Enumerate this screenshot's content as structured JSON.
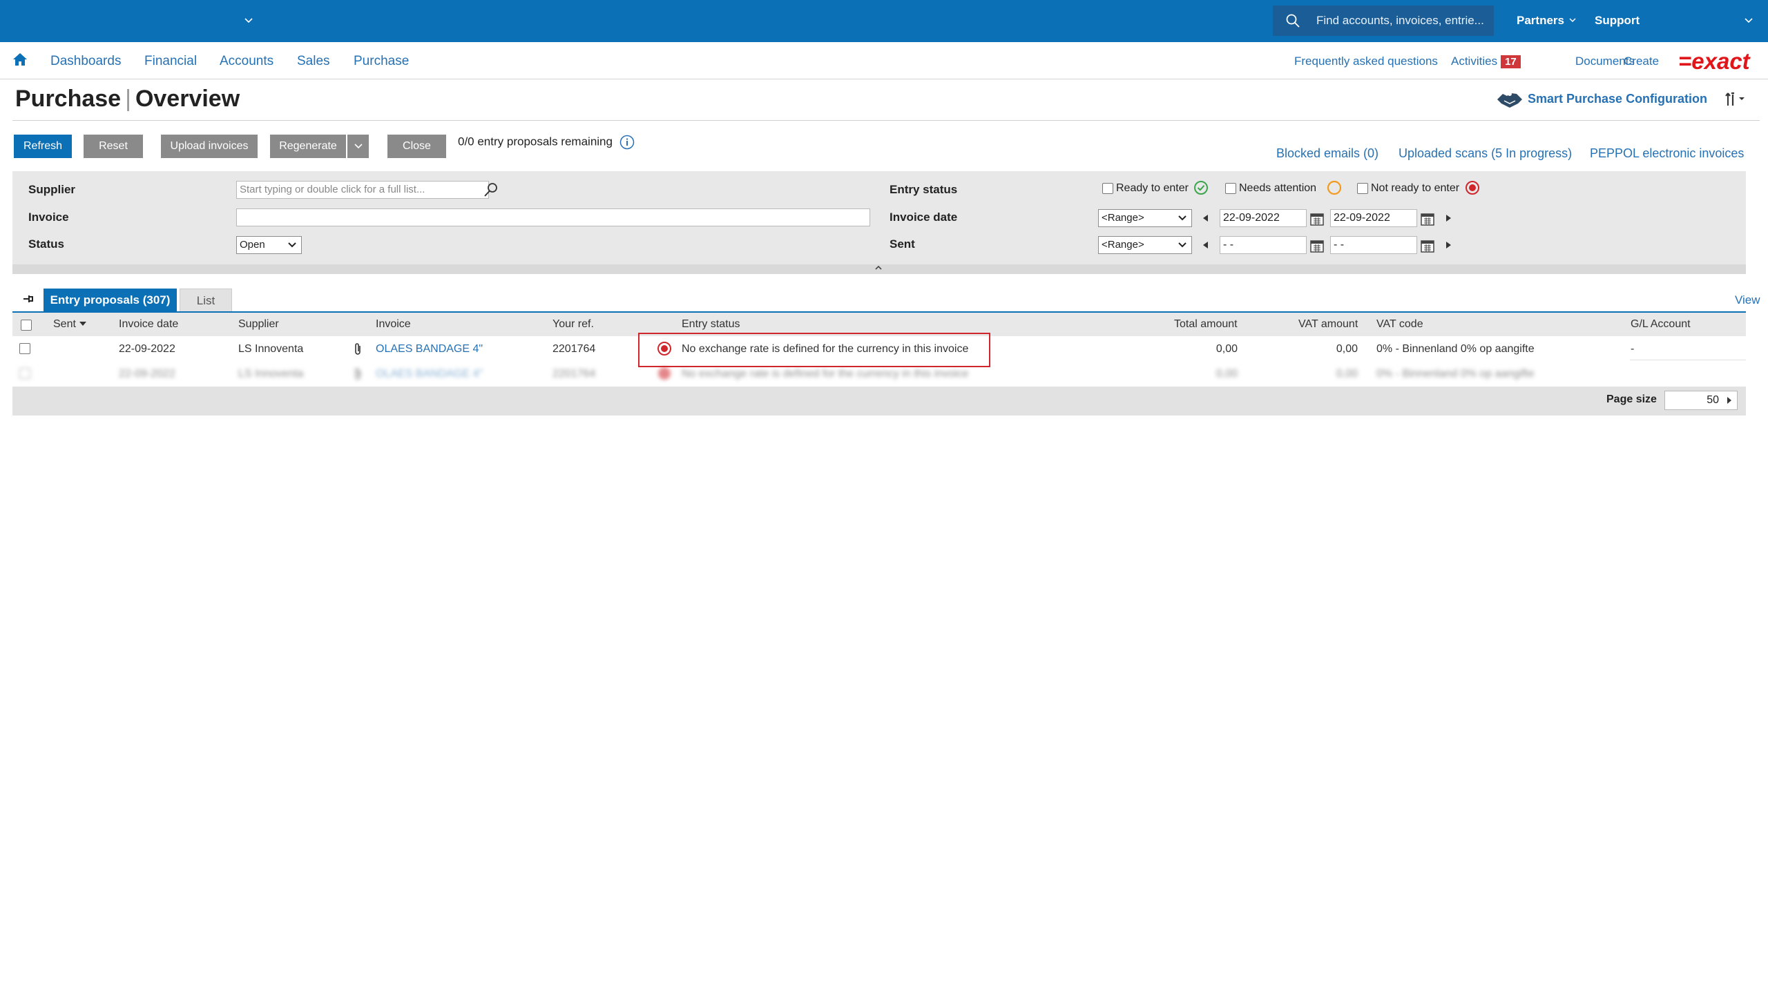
{
  "topbar": {
    "search_placeholder": "Find accounts, invoices, entrie...",
    "partners": "Partners",
    "support": "Support",
    "bg_color": "#0b70b6"
  },
  "nav": {
    "items": [
      "Dashboards",
      "Financial",
      "Accounts",
      "Sales",
      "Purchase"
    ],
    "faq": "Frequently asked questions",
    "activities": "Activities",
    "activities_count": "17",
    "documents": "Documents",
    "create": "Create",
    "logo": "=exact"
  },
  "page": {
    "title_left": "Purchase",
    "title_right": "Overview",
    "smart_config": "Smart Purchase Configuration"
  },
  "toolbar": {
    "refresh": "Refresh",
    "reset": "Reset",
    "upload": "Upload invoices",
    "regenerate": "Regenerate",
    "close": "Close",
    "remaining": "0/0 entry proposals remaining",
    "blocked_emails": "Blocked emails (0)",
    "uploaded_scans": "Uploaded scans (5 In progress)",
    "peppol": "PEPPOL electronic invoices"
  },
  "filters": {
    "supplier_label": "Supplier",
    "supplier_placeholder": "Start typing or double click for a full list...",
    "invoice_label": "Invoice",
    "status_label": "Status",
    "status_value": "Open",
    "entry_status_label": "Entry status",
    "ready": "Ready to enter",
    "needs_attention": "Needs attention",
    "not_ready": "Not ready to enter",
    "invoice_date_label": "Invoice date",
    "invoice_date_mode": "<Range>",
    "invoice_date_from": "22-09-2022",
    "invoice_date_to": "22-09-2022",
    "sent_label": "Sent",
    "sent_mode": "<Range>",
    "sent_from": "- -",
    "sent_to": "- -"
  },
  "tabs": {
    "entry_proposals": "Entry proposals (307)",
    "list": "List",
    "view": "View"
  },
  "table": {
    "headers": {
      "sent": "Sent",
      "invoice_date": "Invoice date",
      "supplier": "Supplier",
      "invoice": "Invoice",
      "your_ref": "Your ref.",
      "entry_status": "Entry status",
      "total_amount": "Total amount",
      "vat_amount": "VAT amount",
      "vat_code": "VAT code",
      "gl_account": "G/L Account"
    },
    "rows": [
      {
        "invoice_date": "22-09-2022",
        "supplier": "LS Innoventa",
        "invoice": "OLAES BANDAGE 4\"",
        "your_ref": "2201764",
        "entry_status": "No exchange rate is defined for the currency in this invoice",
        "total_amount": "0,00",
        "vat_amount": "0,00",
        "vat_code": "0% - Binnenland 0% op aangifte",
        "gl_account": "-"
      },
      {
        "invoice_date": "22-09-2022",
        "supplier": "LS Innoventa",
        "invoice": "OLAES BANDAGE 4\"",
        "your_ref": "2201764",
        "entry_status": "No exchange rate is defined for the currency in this invoice",
        "total_amount": "0,00",
        "vat_amount": "0,00",
        "vat_code": "0% - Binnenland 0% op aangifte",
        "gl_account": ""
      }
    ],
    "page_size_label": "Page size",
    "page_size": "50"
  }
}
